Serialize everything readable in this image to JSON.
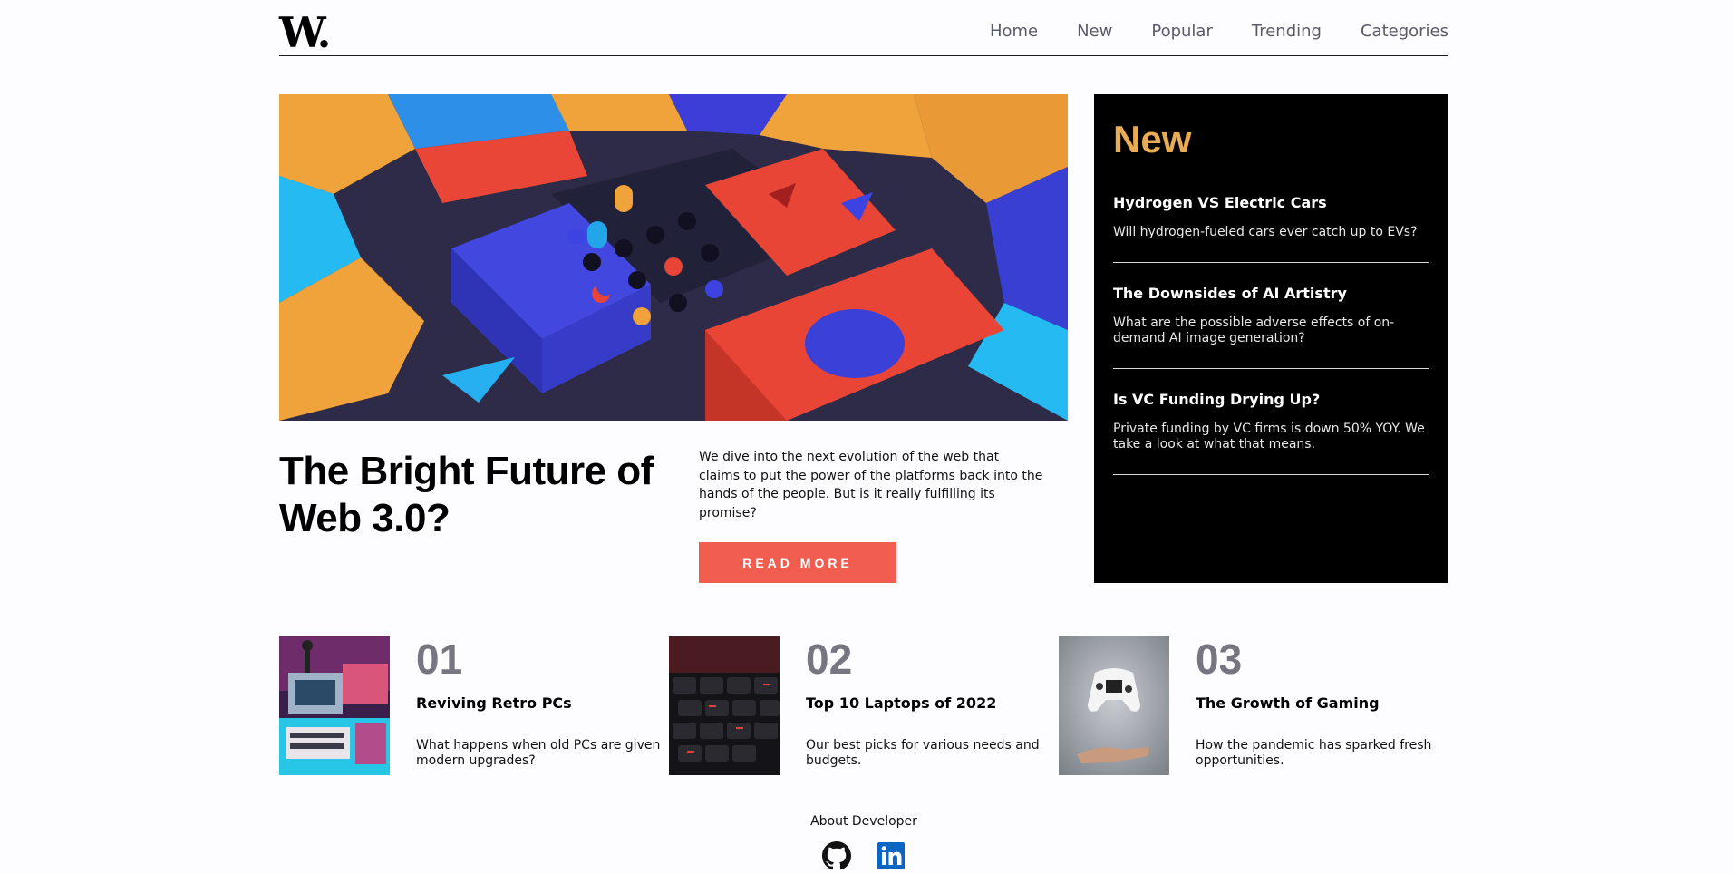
{
  "header": {
    "logo": "W.",
    "nav": [
      "Home",
      "New",
      "Popular",
      "Trending",
      "Categories"
    ]
  },
  "hero": {
    "title": "The Bright Future of Web 3.0?",
    "description": "We dive into the next evolution of the web that claims to put the power of the platforms back into the hands of the people. But is it really fulfilling its promise?",
    "button": "READ MORE"
  },
  "new_panel": {
    "title": "New",
    "items": [
      {
        "title": "Hydrogen VS Electric Cars",
        "text": "Will hydrogen-fueled cars ever catch up to EVs?"
      },
      {
        "title": "The Downsides of AI Artistry",
        "text": "What are the possible adverse effects of on-demand AI image generation?"
      },
      {
        "title": "Is VC Funding Drying Up?",
        "text": "Private funding by VC firms is down 50% YOY. We take a look at what that means."
      }
    ]
  },
  "cards": [
    {
      "num": "01",
      "title": "Reviving Retro PCs",
      "text": "What happens when old PCs are given modern upgrades?"
    },
    {
      "num": "02",
      "title": "Top 10 Laptops of 2022",
      "text": "Our best picks for various needs and budgets."
    },
    {
      "num": "03",
      "title": "The Growth of Gaming",
      "text": "How the pandemic has sparked fresh opportunities."
    }
  ],
  "footer": {
    "label": "About Developer"
  },
  "colors": {
    "accent": "#f15e50",
    "new_heading": "#e9ab53",
    "panel_bg": "#000000",
    "number": "#777680"
  },
  "icons": [
    "github-icon",
    "linkedin-icon"
  ]
}
